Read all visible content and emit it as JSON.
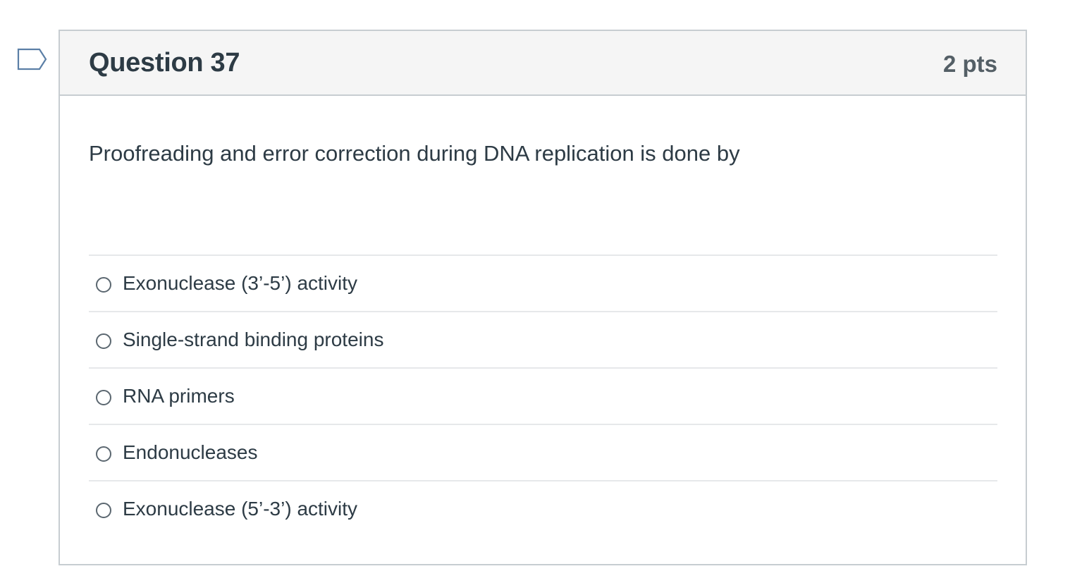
{
  "question": {
    "title": "Question 37",
    "points": "2 pts",
    "text": "Proofreading and error correction during DNA replication is done by",
    "flag_icon": "flag-outline-icon"
  },
  "answers": [
    {
      "label": "Exonuclease (3’-5’) activity",
      "selected": false
    },
    {
      "label": "Single-strand binding proteins",
      "selected": false
    },
    {
      "label": "RNA primers",
      "selected": false
    },
    {
      "label": "Endonucleases",
      "selected": false
    },
    {
      "label": "Exonuclease (5’-3’) activity",
      "selected": false
    }
  ],
  "colors": {
    "header_bg": "#f5f5f5",
    "border": "#c7cdd1",
    "text": "#2d3b45",
    "flag": "#5b7fa6"
  }
}
